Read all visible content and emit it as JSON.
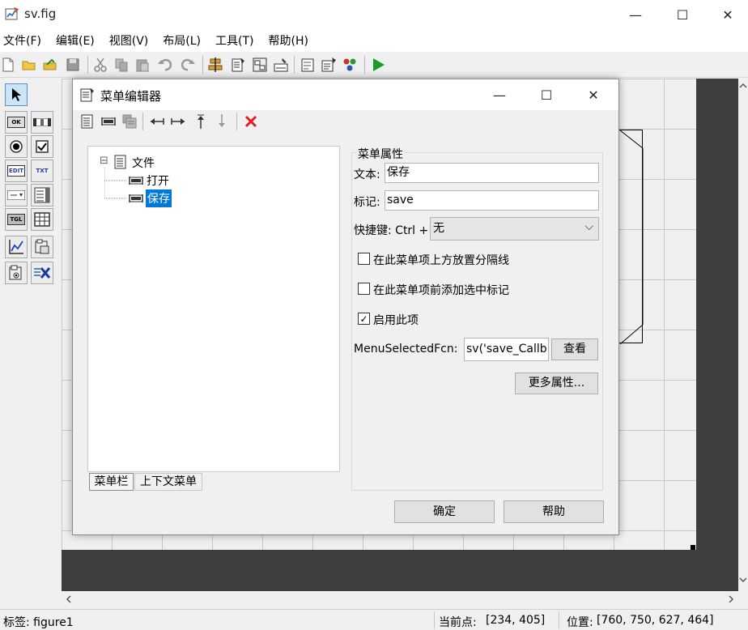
{
  "window": {
    "title": "sv.fig",
    "minimize": "—",
    "maximize": "☐",
    "close": "✕"
  },
  "menubar": [
    "文件(F)",
    "编辑(E)",
    "视图(V)",
    "布局(L)",
    "工具(T)",
    "帮助(H)"
  ],
  "palette_icons": [
    "pointer-icon",
    "pushbutton-icon",
    "slider-icon",
    "radiobutton-icon",
    "checkbox-icon",
    "edit-text-icon",
    "static-text-icon",
    "popup-menu-icon",
    "listbox-icon",
    "toggle-button-icon",
    "table-icon",
    "axes-icon",
    "panel-icon",
    "button-group-icon",
    "activex-icon"
  ],
  "palette_labels": {
    "pushbutton": "OK",
    "edit": "EDIT",
    "text": "TXT",
    "toggle": "TGL"
  },
  "dialog": {
    "title": "菜单编辑器",
    "tree": {
      "root": "文件",
      "children": [
        "打开",
        "保存"
      ],
      "selected": "保存",
      "expand_glyph": "⊟"
    },
    "tabs": [
      "菜单栏",
      "上下文菜单"
    ],
    "group_title": "菜单属性",
    "text_label": "文本:",
    "text_value": "保存",
    "tag_label": "标记:",
    "tag_value": "save",
    "shortcut_label": "快捷键: Ctrl +",
    "shortcut_value": "无",
    "separator_label": "在此菜单项上方放置分隔线",
    "separator_checked": false,
    "check_label": "在此菜单项前添加选中标记",
    "check_checked": false,
    "enable_label": "启用此项",
    "enable_checked": true,
    "callback_label": "MenuSelectedFcn:",
    "callback_value": "sv('save_Callb",
    "view_button": "查看",
    "more_button": "更多属性...",
    "ok_button": "确定",
    "help_button": "帮助",
    "check_mark": "✓",
    "dropdown_arrow": "⌵"
  },
  "statusbar": {
    "tag": "标签: figure1",
    "current_point_label": "当前点:",
    "current_point": "[234, 405]",
    "position_label": "位置:",
    "position": "[760, 750, 627, 464]"
  },
  "colors": {
    "selection": "#0078d7",
    "run": "#1a9a2a",
    "delete": "#e02020"
  }
}
